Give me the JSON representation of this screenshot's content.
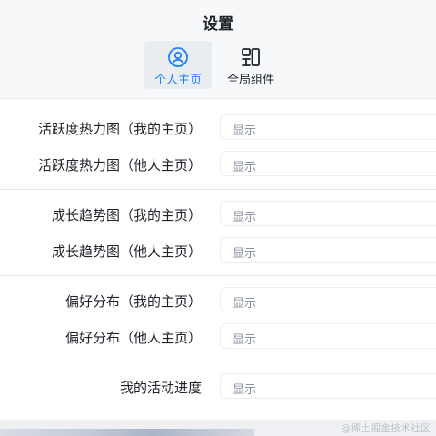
{
  "header": {
    "title": "设置",
    "tabs": [
      {
        "label": "个人主页",
        "icon": "user-circle-icon",
        "active": true
      },
      {
        "label": "全局组件",
        "icon": "components-icon",
        "active": false
      }
    ]
  },
  "settings": [
    {
      "label": "活跃度热力图（我的主页）",
      "value": "显示"
    },
    {
      "label": "活跃度热力图（他人主页）",
      "value": "显示"
    },
    {
      "label": "成长趋势图（我的主页）",
      "value": "显示"
    },
    {
      "label": "成长趋势图（他人主页）",
      "value": "显示"
    },
    {
      "label": "偏好分布（我的主页）",
      "value": "显示"
    },
    {
      "label": "偏好分布（他人主页）",
      "value": "显示"
    },
    {
      "label": "我的活动进度",
      "value": "显示"
    }
  ],
  "watermark": "@稀土掘金技术社区",
  "colors": {
    "accent": "#1e80ff",
    "text": "#1f2329",
    "muted": "#8a919f"
  }
}
